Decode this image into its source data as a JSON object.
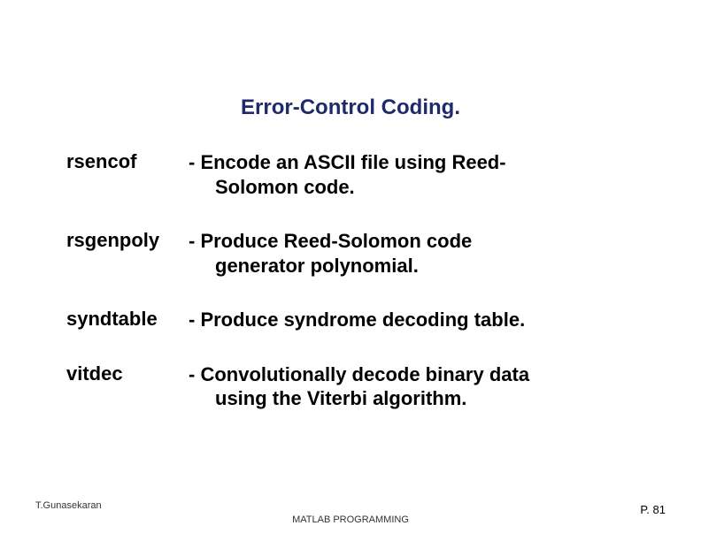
{
  "title": "Error-Control Coding.",
  "rows": [
    {
      "term": "rsencof",
      "desc": "- Encode an ASCII file using Reed-",
      "desc2": "Solomon code."
    },
    {
      "term": "rsgenpoly",
      "desc": "- Produce Reed-Solomon code",
      "desc2": "generator polynomial."
    },
    {
      "term": "syndtable",
      "desc": "- Produce syndrome decoding table.",
      "desc2": ""
    },
    {
      "term": "vitdec",
      "desc": "- Convolutionally decode binary data",
      "desc2": "using the Viterbi algorithm."
    }
  ],
  "footer": {
    "left": "T.Gunasekaran",
    "center": "MATLAB PROGRAMMING",
    "right": "P. 81"
  }
}
